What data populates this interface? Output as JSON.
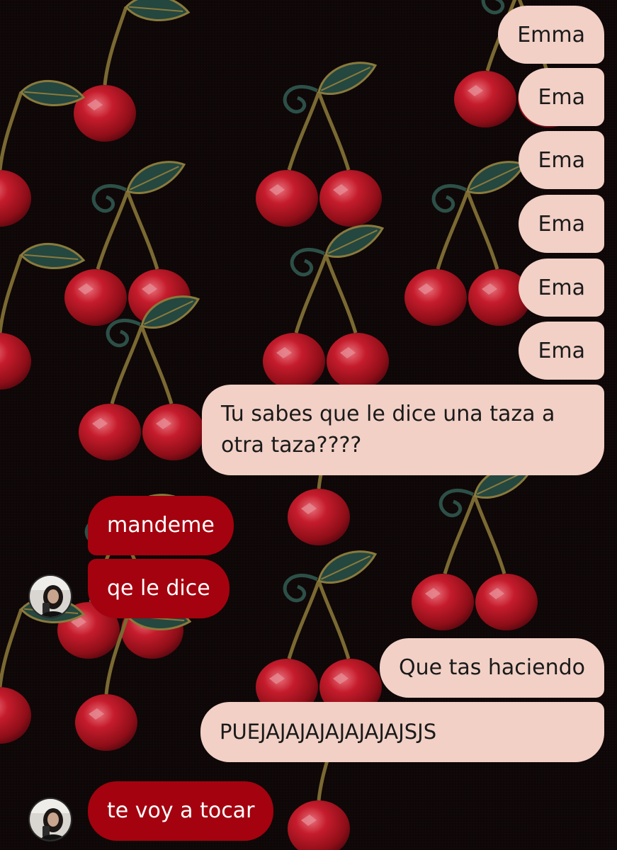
{
  "theme": {
    "outgoing_bubble_color": "#f2d0c6",
    "outgoing_text_color": "#1a1a1a",
    "incoming_bubble_color": "#a4020f",
    "incoming_text_color": "#ffffff",
    "wallpaper": "black fabric with red cherries and green leaves"
  },
  "messages": [
    {
      "sender": "me",
      "text": "Emma"
    },
    {
      "sender": "me",
      "text": "Ema"
    },
    {
      "sender": "me",
      "text": "Ema"
    },
    {
      "sender": "me",
      "text": "Ema"
    },
    {
      "sender": "me",
      "text": "Ema"
    },
    {
      "sender": "me",
      "text": "Ema"
    },
    {
      "sender": "me",
      "text": "Tu sabes que le dice una taza a otra taza????"
    },
    {
      "sender": "them",
      "text": "mandeme"
    },
    {
      "sender": "them",
      "text": "qe le dice"
    },
    {
      "sender": "me",
      "text": "Que tas haciendo"
    },
    {
      "sender": "me",
      "text": "PUEJAJAJAJAJAJAJAJSJS"
    },
    {
      "sender": "them",
      "text": "te voy a tocar"
    }
  ]
}
